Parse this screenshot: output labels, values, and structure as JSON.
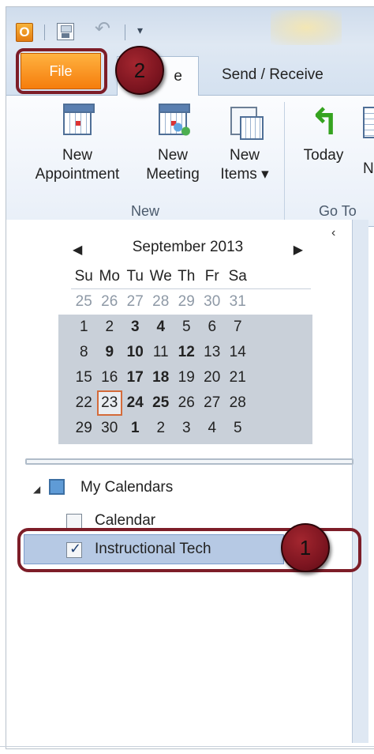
{
  "qat": {
    "app_icon_letter": "O"
  },
  "tabs": {
    "file": "File",
    "home_suffix": "e",
    "send_receive": "Send / Receive"
  },
  "ribbon": {
    "new_appointment": [
      "New",
      "Appointment"
    ],
    "new_meeting": [
      "New",
      "Meeting"
    ],
    "new_items": [
      "New",
      "Items ▾"
    ],
    "today": "Today",
    "next_partial": "N",
    "groups": {
      "new": "New",
      "goto": "Go To"
    }
  },
  "calendar": {
    "month_title": "September 2013",
    "days_of_week": [
      "Su",
      "Mo",
      "Tu",
      "We",
      "Th",
      "Fr",
      "Sa"
    ],
    "weeks": [
      [
        "25",
        "26",
        "27",
        "28",
        "29",
        "30",
        "31"
      ],
      [
        "1",
        "2",
        "3",
        "4",
        "5",
        "6",
        "7"
      ],
      [
        "8",
        "9",
        "10",
        "11",
        "12",
        "13",
        "14"
      ],
      [
        "15",
        "16",
        "17",
        "18",
        "19",
        "20",
        "21"
      ],
      [
        "22",
        "23",
        "24",
        "25",
        "26",
        "27",
        "28"
      ],
      [
        "29",
        "30",
        "1",
        "2",
        "3",
        "4",
        "5"
      ]
    ],
    "today": "23"
  },
  "my_calendars": {
    "header": "My Calendars",
    "items": [
      {
        "label": "Calendar",
        "checked": false
      },
      {
        "label": "Instructional Tech",
        "checked": true
      }
    ]
  },
  "annotations": {
    "badge_1": "1",
    "badge_2": "2"
  },
  "colors": {
    "file_tab": "#f57d0c",
    "highlight": "#7d1d28",
    "selection": "#b6c9e4"
  }
}
